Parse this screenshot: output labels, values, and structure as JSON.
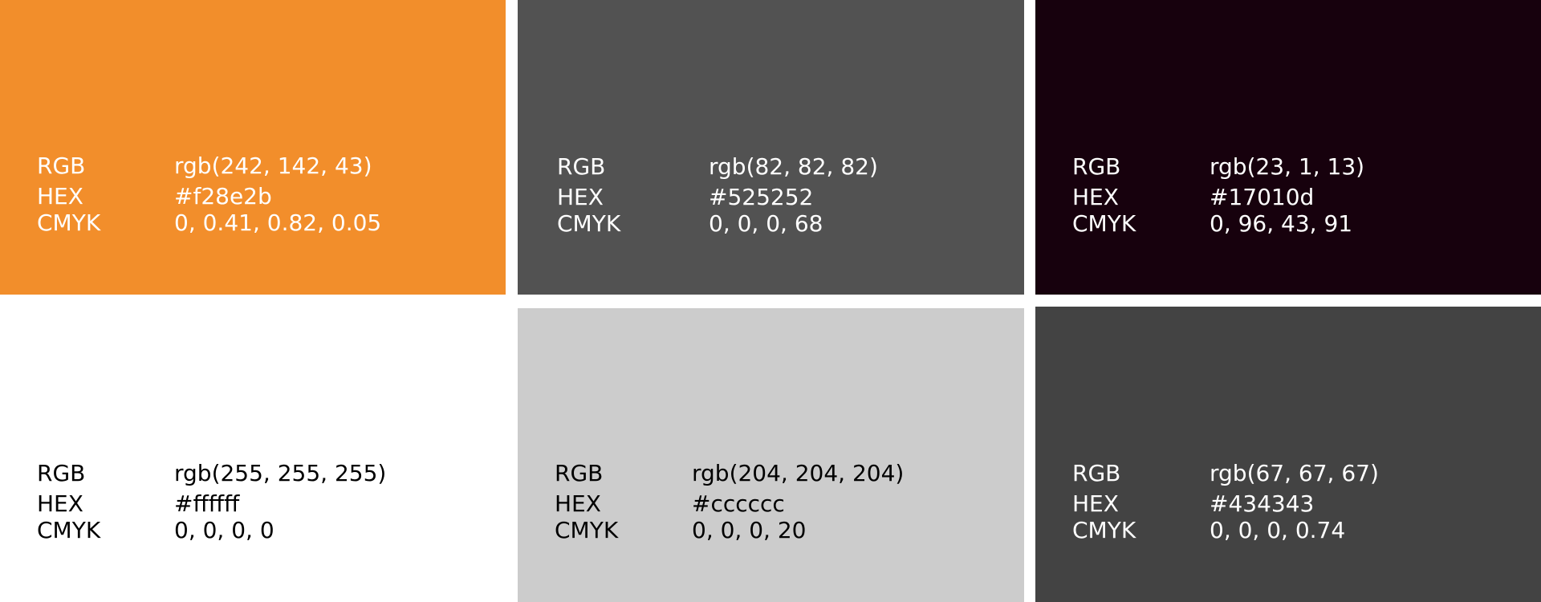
{
  "labels": {
    "rgb": "RGB",
    "hex": "HEX",
    "cmyk": "CMYK"
  },
  "swatches": [
    {
      "color": "#f28e2b",
      "text_color": "#ffffff",
      "rgb": "rgb(242, 142, 43)",
      "hex": "#f28e2b",
      "cmyk": "0, 0.41, 0.82, 0.05"
    },
    {
      "color": "#525252",
      "text_color": "#ffffff",
      "rgb": "rgb(82, 82, 82)",
      "hex": "#525252",
      "cmyk": "0, 0, 0, 68"
    },
    {
      "color": "#17010d",
      "text_color": "#ffffff",
      "rgb": "rgb(23, 1, 13)",
      "hex": "#17010d",
      "cmyk": "0, 96, 43, 91"
    },
    {
      "color": "#ffffff",
      "text_color": "#000000",
      "rgb": "rgb(255, 255, 255)",
      "hex": "#ffffff",
      "cmyk": "0, 0, 0, 0"
    },
    {
      "color": "#cccccc",
      "text_color": "#000000",
      "rgb": "rgb(204, 204, 204)",
      "hex": "#cccccc",
      "cmyk": "0, 0, 0, 20"
    },
    {
      "color": "#434343",
      "text_color": "#ffffff",
      "rgb": "rgb(67, 67, 67)",
      "hex": "#434343",
      "cmyk": "0, 0, 0, 0.74"
    }
  ]
}
